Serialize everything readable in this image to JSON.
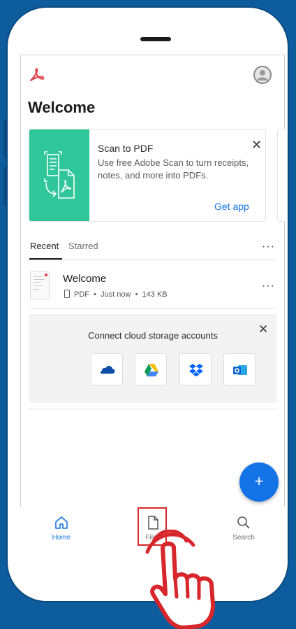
{
  "header": {
    "title": "Welcome",
    "logo_icon": "acrobat-logo-icon",
    "avatar_icon": "profile-avatar-icon"
  },
  "scan_card": {
    "title": "Scan to PDF",
    "description": "Use free Adobe Scan to turn receipts, notes, and more into PDFs.",
    "action_label": "Get app",
    "close_glyph": "✕",
    "art_color": "#2fc79a"
  },
  "tabs": [
    {
      "label": "Recent",
      "selected": true
    },
    {
      "label": "Starred",
      "selected": false
    }
  ],
  "more_glyph": "···",
  "recent_files": [
    {
      "name": "Welcome",
      "meta": "PDF  •  Just now  •  143 KB"
    }
  ],
  "cloud_card": {
    "title": "Connect cloud storage accounts",
    "close_glyph": "✕",
    "providers": [
      "onedrive-icon",
      "google-drive-icon",
      "dropbox-icon",
      "outlook-icon"
    ]
  },
  "fab": {
    "glyph": "+"
  },
  "bottom_nav": [
    {
      "label": "Home",
      "icon": "home-icon",
      "active": true
    },
    {
      "label": "Files",
      "icon": "file-icon",
      "active": false
    },
    {
      "label": "Search",
      "icon": "search-icon",
      "active": false
    }
  ],
  "colors": {
    "accent": "#1473e6",
    "background": "#0d5c9e",
    "highlight": "#d7262c",
    "brand_red": "#e34850"
  }
}
